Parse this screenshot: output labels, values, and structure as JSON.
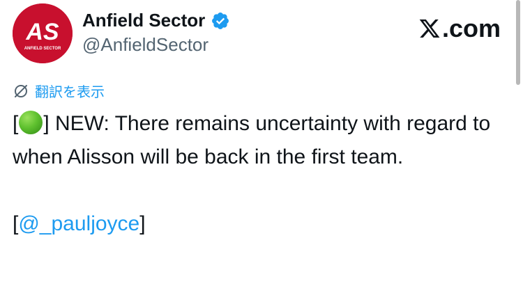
{
  "author": {
    "display_name": "Anfield Sector",
    "handle": "@AnfieldSector",
    "avatar_text": "AS",
    "avatar_subtext": "ANFIELD SECTOR",
    "verified": true,
    "avatar_color": "#c8102e"
  },
  "site": {
    "logo_text": ".com",
    "logo_icon": "x-logo-icon"
  },
  "translate": {
    "label": "翻訳を表示",
    "icon": "translate-icon"
  },
  "tweet": {
    "bracket_open": "[",
    "emoji": "green-circle",
    "line1_rest": "] NEW: There remains uncertainty with regard to when Alisson will be back in the first team.",
    "mention_open": "[",
    "mention": "@_pauljoyce",
    "mention_close": "]"
  },
  "colors": {
    "text": "#0f1419",
    "secondary": "#536471",
    "link": "#1d9bf0"
  }
}
